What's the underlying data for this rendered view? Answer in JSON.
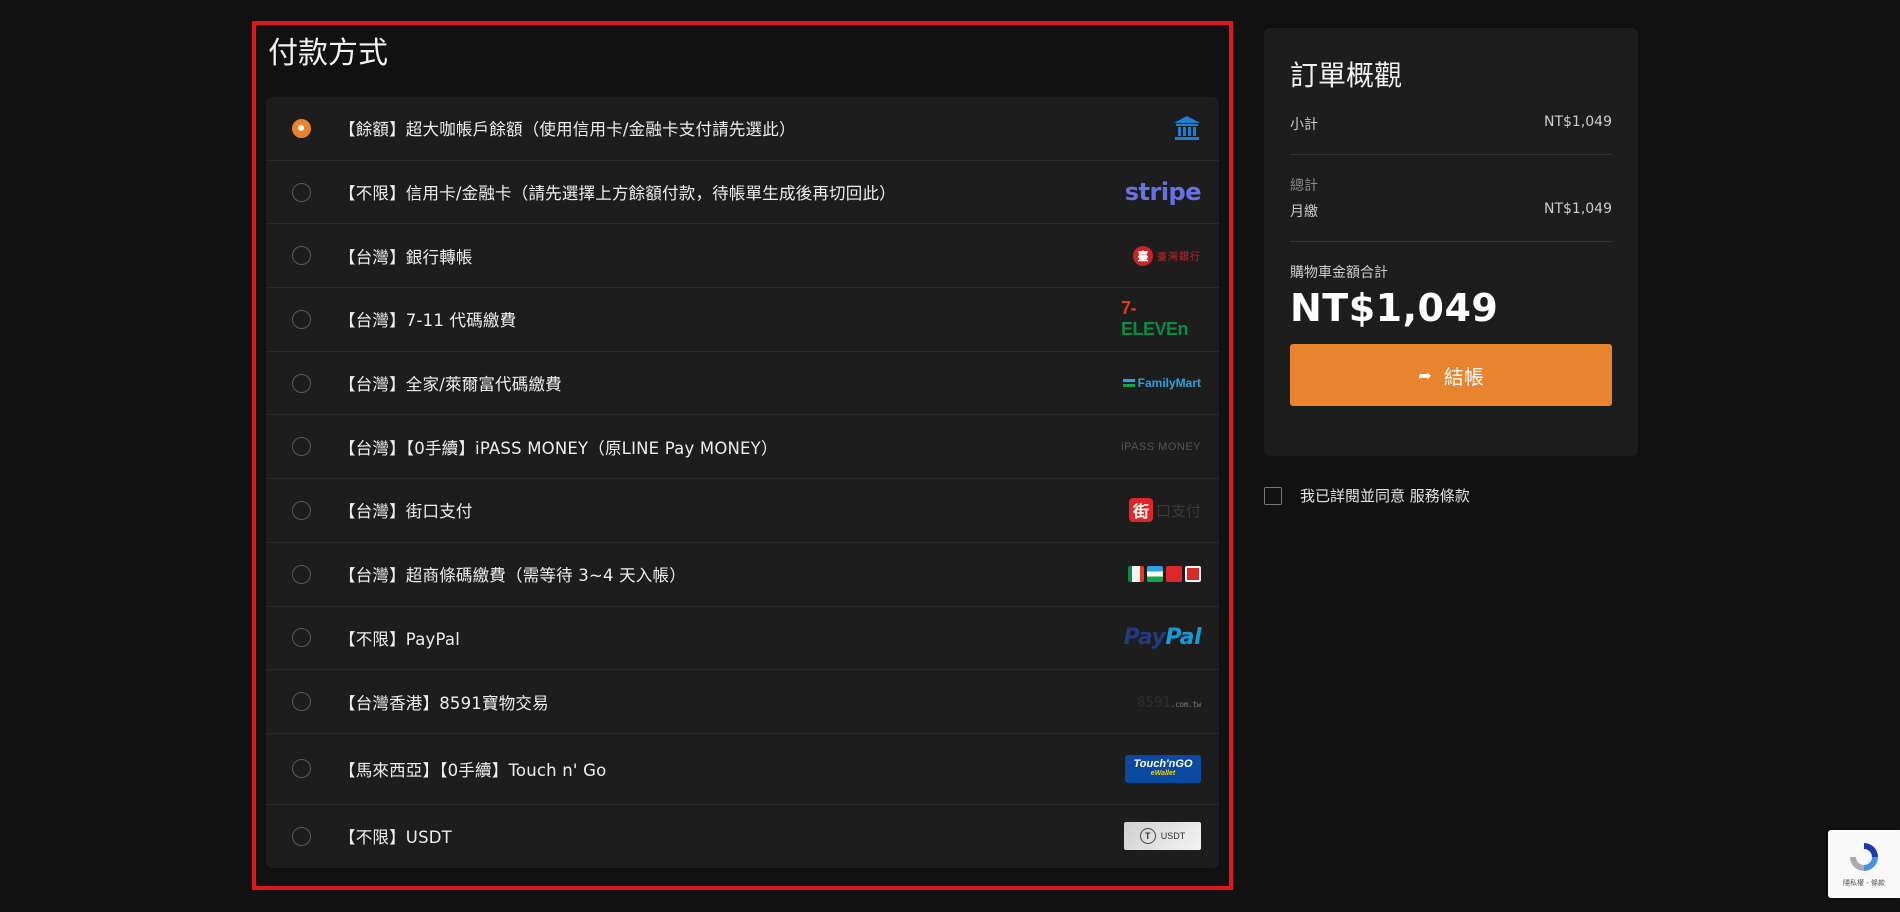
{
  "payment": {
    "title": "付款方式",
    "methods": [
      {
        "label": "【餘額】超大咖帳戶餘額（使用信用卡/金融卡支付請先選此）",
        "logo": "bank-icon",
        "checked": true
      },
      {
        "label": "【不限】信用卡/金融卡（請先選擇上方餘額付款，待帳單生成後再切回此）",
        "logo": "stripe-logo",
        "logo_text": "stripe"
      },
      {
        "label": "【台灣】銀行轉帳",
        "logo": "bank-of-taiwan-logo",
        "logo_text": "臺灣銀行"
      },
      {
        "label": "【台灣】7-11 代碼繳費",
        "logo": "seven-eleven-logo",
        "logo_text_a": "7-",
        "logo_text_b": "ELEVEn"
      },
      {
        "label": "【台灣】全家/萊爾富代碼繳費",
        "logo": "familymart-logo",
        "logo_text": "FamilyMart"
      },
      {
        "label": "【台灣】【0手續】iPASS MONEY（原LINE Pay MONEY）",
        "logo": "ipass-money-logo",
        "logo_text": "iPASS MONEY"
      },
      {
        "label": "【台灣】街口支付",
        "logo": "jkopay-logo",
        "logo_text_a": "街",
        "logo_text_b": "口支付"
      },
      {
        "label": "【台灣】超商條碼繳費（需等待 3~4 天入帳）",
        "logo": "convenience-stores-logo"
      },
      {
        "label": "【不限】PayPal",
        "logo": "paypal-logo",
        "logo_text_a": "Pay",
        "logo_text_b": "Pal"
      },
      {
        "label": "【台灣香港】8591寶物交易",
        "logo": "8591-logo",
        "logo_text": "8591",
        "logo_sub": ".com.tw"
      },
      {
        "label": "【馬來西亞】【0手續】Touch n' Go",
        "logo": "touch-n-go-logo",
        "logo_text": "Touch'nGO",
        "logo_sub": "eWallet"
      },
      {
        "label": "【不限】USDT",
        "logo": "usdt-logo",
        "logo_text": "USDT"
      }
    ]
  },
  "summary": {
    "title": "訂單概觀",
    "subtotal_label": "小計",
    "subtotal_value": "NT$1,049",
    "total_section_label": "總計",
    "monthly_label": "月繳",
    "monthly_value": "NT$1,049",
    "cart_total_label": "購物車金額合計",
    "cart_total_value": "NT$1,049",
    "checkout_label": "結帳"
  },
  "terms": {
    "text": "我已詳閱並同意 服務條款"
  },
  "recaptcha": {
    "text": "隱私權 - 條款"
  },
  "colors": {
    "accent": "#e8832e",
    "highlight_border": "#e0161d",
    "background": "#111111",
    "card": "#1d1d1d"
  }
}
